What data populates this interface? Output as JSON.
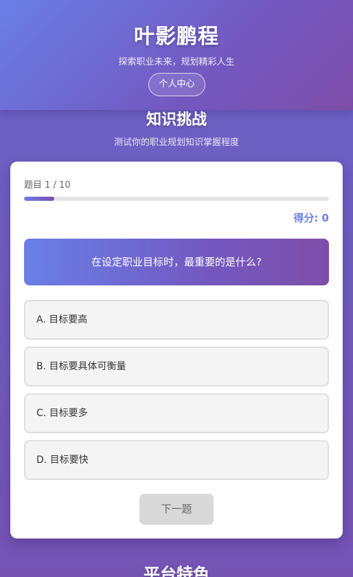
{
  "header": {
    "brand": "叶影鹏程",
    "tagline": "探索职业未来，规划精彩人生",
    "profile_button": "个人中心"
  },
  "quiz_section": {
    "title": "知识挑战",
    "subtitle": "测试你的职业规划知识掌握程度"
  },
  "quiz": {
    "counter_text": "题目 1 / 10",
    "progress_fraction": 0.1,
    "score_text": "得分: 0",
    "question": "在设定职业目标时，最重要的是什么?",
    "options": [
      "A. 目标要高",
      "B. 目标要具体可衡量",
      "C. 目标要多",
      "D. 目标要快"
    ],
    "next_button": "下一题"
  },
  "features_section": {
    "title": "平台特色"
  },
  "colors": {
    "accent_start": "#6a7fe6",
    "accent_end": "#7d4ea8",
    "score": "#6a7fe6"
  }
}
